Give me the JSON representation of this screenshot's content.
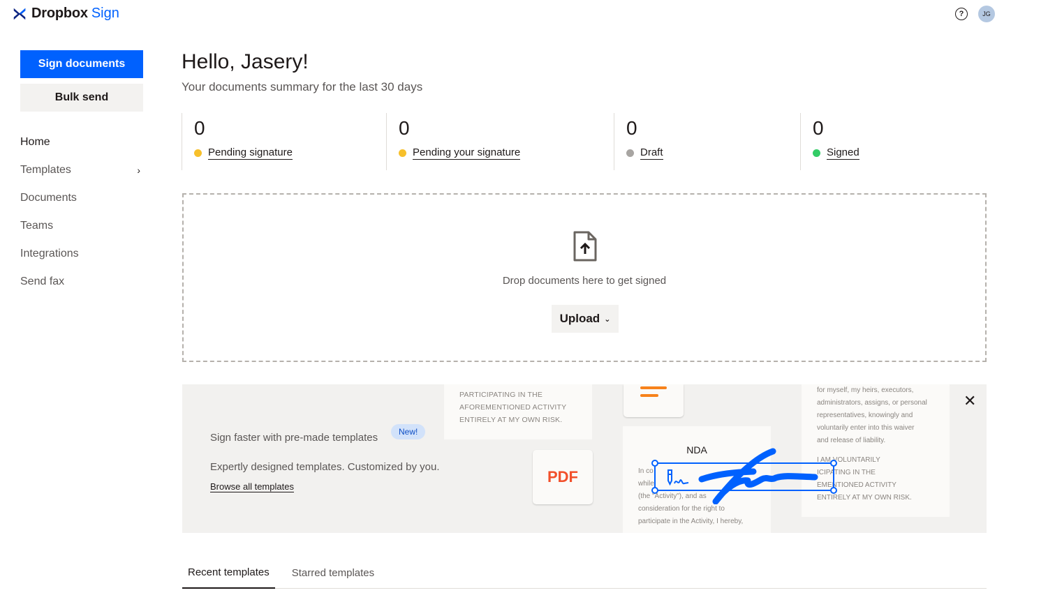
{
  "brand": {
    "name": "Dropbox",
    "product": "Sign",
    "logo_icon": "dropbox-logo-icon",
    "accent": "#0061fe"
  },
  "header": {
    "help_icon": "help-circle-icon",
    "avatar_initials": "JG"
  },
  "sidebar": {
    "primary_button": "Sign documents",
    "secondary_button": "Bulk send",
    "items": [
      {
        "label": "Home"
      },
      {
        "label": "Templates"
      },
      {
        "label": "Documents"
      },
      {
        "label": "Teams"
      },
      {
        "label": "Integrations"
      },
      {
        "label": "Send fax"
      }
    ]
  },
  "main": {
    "greeting": "Hello, Jasery!",
    "subtitle": "Your documents summary for the last 30 days",
    "stats": [
      {
        "count": "0",
        "label": "Pending signature",
        "color": "#f7c02b"
      },
      {
        "count": "0",
        "label": "Pending your signature",
        "color": "#f7c02b"
      },
      {
        "count": "0",
        "label": "Draft",
        "color": "#a8a5a2"
      },
      {
        "count": "0",
        "label": "Signed",
        "color": "#33cc66"
      }
    ],
    "dropzone": {
      "icon": "file-upload-icon",
      "text": "Drop documents here to get signed",
      "upload_button": "Upload"
    },
    "promo": {
      "title": "Sign faster with pre-made templates",
      "badge": "New!",
      "description": "Expertly designed templates. Customized by you.",
      "link": "Browse all templates",
      "card_a_lines": [
        "PARTICIPATING IN THE",
        "AFOREMENTIONED ACTIVITY",
        "ENTIRELY AT MY OWN RISK."
      ],
      "pdf_label": "PDF",
      "nda_title": "NDA",
      "nda_lines": [
        "In co",
        "while",
        "(the \"Activity\"), and as",
        "consideration for the right to",
        "participate in the Activity, I hereby,"
      ],
      "card_c_lines": [
        "for myself, my heirs, executors,",
        "administrators, assigns, or personal",
        "representatives, knowingly and",
        "voluntarily enter into this waiver",
        "and release of liability.",
        "",
        "I AM VOLUNTARILY",
        "ICIPATING IN THE",
        "EMENTIONED ACTIVITY",
        "ENTIRELY AT MY OWN RISK."
      ]
    },
    "tabs": [
      {
        "label": "Recent templates"
      },
      {
        "label": "Starred templates"
      }
    ]
  }
}
